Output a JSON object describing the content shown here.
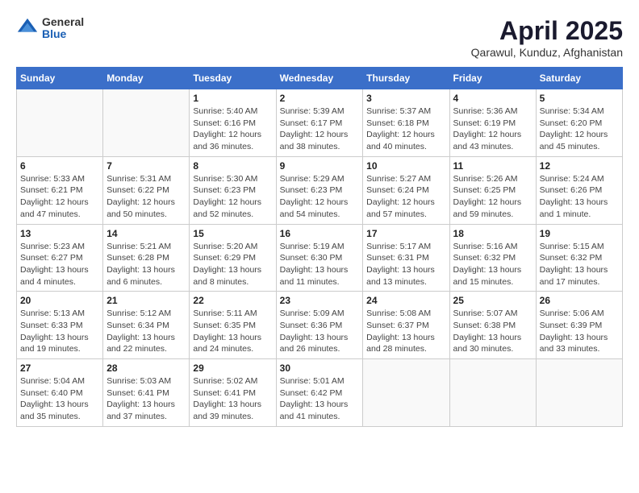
{
  "logo": {
    "general": "General",
    "blue": "Blue"
  },
  "title": "April 2025",
  "location": "Qarawul, Kunduz, Afghanistan",
  "days_header": [
    "Sunday",
    "Monday",
    "Tuesday",
    "Wednesday",
    "Thursday",
    "Friday",
    "Saturday"
  ],
  "weeks": [
    [
      {
        "num": "",
        "info": ""
      },
      {
        "num": "",
        "info": ""
      },
      {
        "num": "1",
        "info": "Sunrise: 5:40 AM\nSunset: 6:16 PM\nDaylight: 12 hours\nand 36 minutes."
      },
      {
        "num": "2",
        "info": "Sunrise: 5:39 AM\nSunset: 6:17 PM\nDaylight: 12 hours\nand 38 minutes."
      },
      {
        "num": "3",
        "info": "Sunrise: 5:37 AM\nSunset: 6:18 PM\nDaylight: 12 hours\nand 40 minutes."
      },
      {
        "num": "4",
        "info": "Sunrise: 5:36 AM\nSunset: 6:19 PM\nDaylight: 12 hours\nand 43 minutes."
      },
      {
        "num": "5",
        "info": "Sunrise: 5:34 AM\nSunset: 6:20 PM\nDaylight: 12 hours\nand 45 minutes."
      }
    ],
    [
      {
        "num": "6",
        "info": "Sunrise: 5:33 AM\nSunset: 6:21 PM\nDaylight: 12 hours\nand 47 minutes."
      },
      {
        "num": "7",
        "info": "Sunrise: 5:31 AM\nSunset: 6:22 PM\nDaylight: 12 hours\nand 50 minutes."
      },
      {
        "num": "8",
        "info": "Sunrise: 5:30 AM\nSunset: 6:23 PM\nDaylight: 12 hours\nand 52 minutes."
      },
      {
        "num": "9",
        "info": "Sunrise: 5:29 AM\nSunset: 6:23 PM\nDaylight: 12 hours\nand 54 minutes."
      },
      {
        "num": "10",
        "info": "Sunrise: 5:27 AM\nSunset: 6:24 PM\nDaylight: 12 hours\nand 57 minutes."
      },
      {
        "num": "11",
        "info": "Sunrise: 5:26 AM\nSunset: 6:25 PM\nDaylight: 12 hours\nand 59 minutes."
      },
      {
        "num": "12",
        "info": "Sunrise: 5:24 AM\nSunset: 6:26 PM\nDaylight: 13 hours\nand 1 minute."
      }
    ],
    [
      {
        "num": "13",
        "info": "Sunrise: 5:23 AM\nSunset: 6:27 PM\nDaylight: 13 hours\nand 4 minutes."
      },
      {
        "num": "14",
        "info": "Sunrise: 5:21 AM\nSunset: 6:28 PM\nDaylight: 13 hours\nand 6 minutes."
      },
      {
        "num": "15",
        "info": "Sunrise: 5:20 AM\nSunset: 6:29 PM\nDaylight: 13 hours\nand 8 minutes."
      },
      {
        "num": "16",
        "info": "Sunrise: 5:19 AM\nSunset: 6:30 PM\nDaylight: 13 hours\nand 11 minutes."
      },
      {
        "num": "17",
        "info": "Sunrise: 5:17 AM\nSunset: 6:31 PM\nDaylight: 13 hours\nand 13 minutes."
      },
      {
        "num": "18",
        "info": "Sunrise: 5:16 AM\nSunset: 6:32 PM\nDaylight: 13 hours\nand 15 minutes."
      },
      {
        "num": "19",
        "info": "Sunrise: 5:15 AM\nSunset: 6:32 PM\nDaylight: 13 hours\nand 17 minutes."
      }
    ],
    [
      {
        "num": "20",
        "info": "Sunrise: 5:13 AM\nSunset: 6:33 PM\nDaylight: 13 hours\nand 19 minutes."
      },
      {
        "num": "21",
        "info": "Sunrise: 5:12 AM\nSunset: 6:34 PM\nDaylight: 13 hours\nand 22 minutes."
      },
      {
        "num": "22",
        "info": "Sunrise: 5:11 AM\nSunset: 6:35 PM\nDaylight: 13 hours\nand 24 minutes."
      },
      {
        "num": "23",
        "info": "Sunrise: 5:09 AM\nSunset: 6:36 PM\nDaylight: 13 hours\nand 26 minutes."
      },
      {
        "num": "24",
        "info": "Sunrise: 5:08 AM\nSunset: 6:37 PM\nDaylight: 13 hours\nand 28 minutes."
      },
      {
        "num": "25",
        "info": "Sunrise: 5:07 AM\nSunset: 6:38 PM\nDaylight: 13 hours\nand 30 minutes."
      },
      {
        "num": "26",
        "info": "Sunrise: 5:06 AM\nSunset: 6:39 PM\nDaylight: 13 hours\nand 33 minutes."
      }
    ],
    [
      {
        "num": "27",
        "info": "Sunrise: 5:04 AM\nSunset: 6:40 PM\nDaylight: 13 hours\nand 35 minutes."
      },
      {
        "num": "28",
        "info": "Sunrise: 5:03 AM\nSunset: 6:41 PM\nDaylight: 13 hours\nand 37 minutes."
      },
      {
        "num": "29",
        "info": "Sunrise: 5:02 AM\nSunset: 6:41 PM\nDaylight: 13 hours\nand 39 minutes."
      },
      {
        "num": "30",
        "info": "Sunrise: 5:01 AM\nSunset: 6:42 PM\nDaylight: 13 hours\nand 41 minutes."
      },
      {
        "num": "",
        "info": ""
      },
      {
        "num": "",
        "info": ""
      },
      {
        "num": "",
        "info": ""
      }
    ]
  ]
}
